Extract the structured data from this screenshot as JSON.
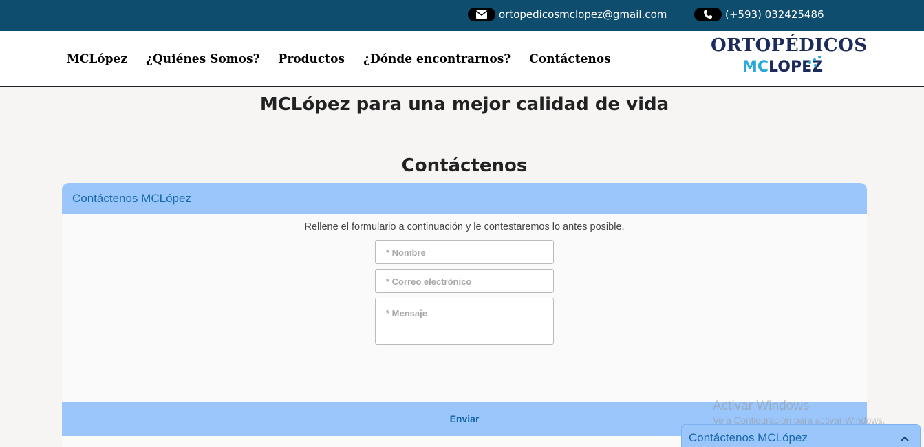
{
  "topbar": {
    "email": "ortopedicosmclopez@gmail.com",
    "phone": "(+593) 032425486",
    "email_icon": "envelope-icon",
    "phone_icon": "phone-icon",
    "background": "#0e4d6e"
  },
  "nav": {
    "items": [
      "MCLópez",
      "¿Quiénes Somos?",
      "Productos",
      "¿Dónde encontrarnos?",
      "Contáctenos"
    ]
  },
  "logo": {
    "line1": "ORTOPÉDICOS",
    "line2_mc": "MC",
    "line2_rest": "LOPEZ"
  },
  "main": {
    "heading": "MCLópez para una mejor calidad de vida",
    "section_title": "Contáctenos"
  },
  "form": {
    "header": "Contáctenos MCLópez",
    "intro": "Rellene el formulario a continuación y le contestaremos lo antes posible.",
    "name_placeholder": "* Nombre",
    "email_placeholder": "* Correo electrónico",
    "message_placeholder": "* Mensaje",
    "submit_label": "Enviar",
    "accent": "#9bc6fc",
    "accent_text": "#1767a9"
  },
  "watermark": {
    "line1": "Activar Windows",
    "line2": "Ve a Configuración para activar Windows."
  },
  "chat": {
    "label": "Contáctenos MCLópez",
    "icon": "chevron-up-icon"
  }
}
